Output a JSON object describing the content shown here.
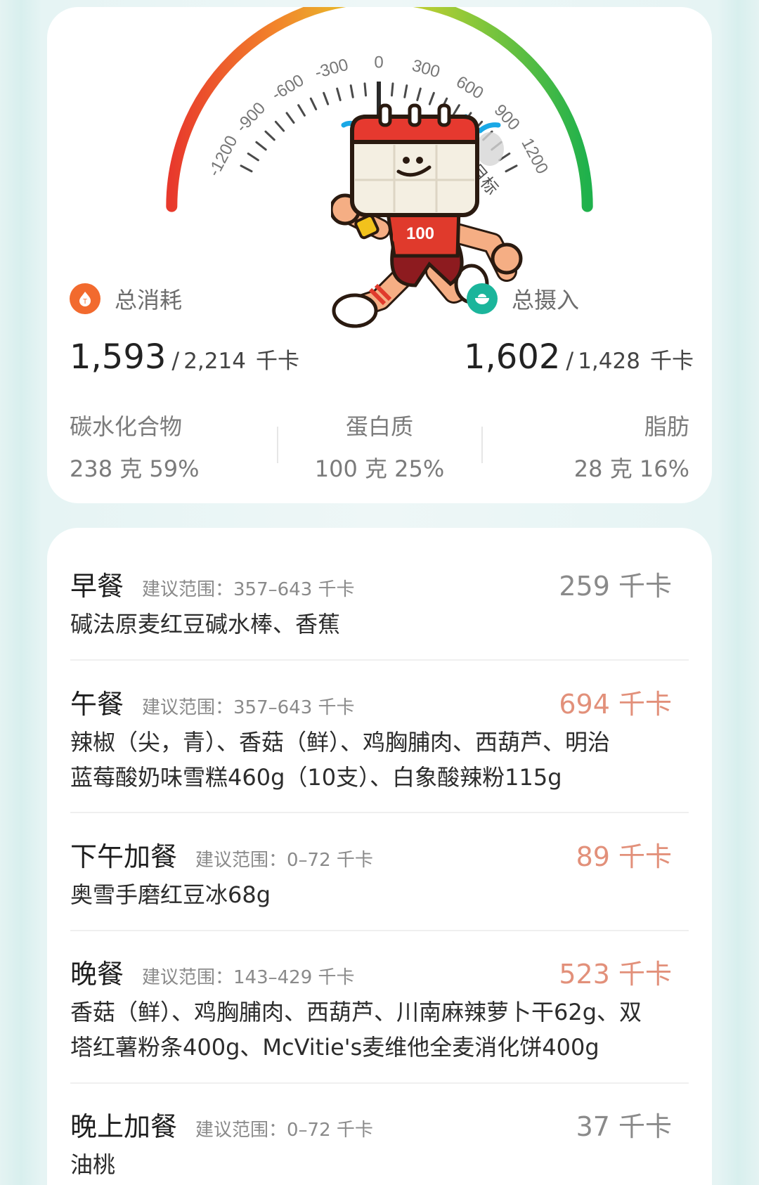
{
  "summary": {
    "gauge": {
      "ticks": [
        "-1200",
        "-900",
        "-600",
        "-300",
        "0",
        "300",
        "600",
        "900",
        "1200"
      ],
      "target_label": "目标",
      "mascot_number": "100"
    },
    "burn": {
      "label": "总消耗",
      "value": "1,593",
      "slash": "/",
      "target": "2,214",
      "unit": "千卡",
      "icon": "flame-icon",
      "color": "#f26a2e"
    },
    "intake": {
      "label": "总摄入",
      "value": "1,602",
      "slash": "/",
      "target": "1,428",
      "unit": "千卡",
      "icon": "bowl-icon",
      "color": "#1bb59b"
    },
    "macros": [
      {
        "name": "碳水化合物",
        "value": "238 克  59%"
      },
      {
        "name": "蛋白质",
        "value": "100 克  25%"
      },
      {
        "name": "脂肪",
        "value": "28 克  16%"
      }
    ]
  },
  "meals": [
    {
      "name": "早餐",
      "range": "建议范围：357–643 千卡",
      "kcal": "259 千卡",
      "status": "normal",
      "foods": [
        "碱法原麦红豆碱水棒、香蕉"
      ]
    },
    {
      "name": "午餐",
      "range": "建议范围：357–643 千卡",
      "kcal": "694 千卡",
      "status": "over",
      "foods": [
        "辣椒（尖，青）、香菇（鲜）、鸡胸脯肉、西葫芦、明治",
        "蓝莓酸奶味雪糕460g（10支）、白象酸辣粉115g"
      ]
    },
    {
      "name": "下午加餐",
      "range": "建议范围：0–72 千卡",
      "kcal": "89 千卡",
      "status": "over",
      "foods": [
        "奥雪手磨红豆冰68g"
      ]
    },
    {
      "name": "晚餐",
      "range": "建议范围：143–429 千卡",
      "kcal": "523 千卡",
      "status": "over",
      "foods": [
        "香菇（鲜）、鸡胸脯肉、西葫芦、川南麻辣萝卜干62g、双",
        "塔红薯粉条400g、McVitie's麦维他全麦消化饼400g"
      ]
    },
    {
      "name": "晚上加餐",
      "range": "建议范围：0–72 千卡",
      "kcal": "37 千卡",
      "status": "normal",
      "foods": [
        "油桃"
      ]
    }
  ],
  "colors": {
    "over": "#e2907a",
    "normal": "#8a8a8a",
    "gauge_start": "#e8392c",
    "gauge_mid": "#e3d12a",
    "gauge_end": "#1fb14c"
  }
}
